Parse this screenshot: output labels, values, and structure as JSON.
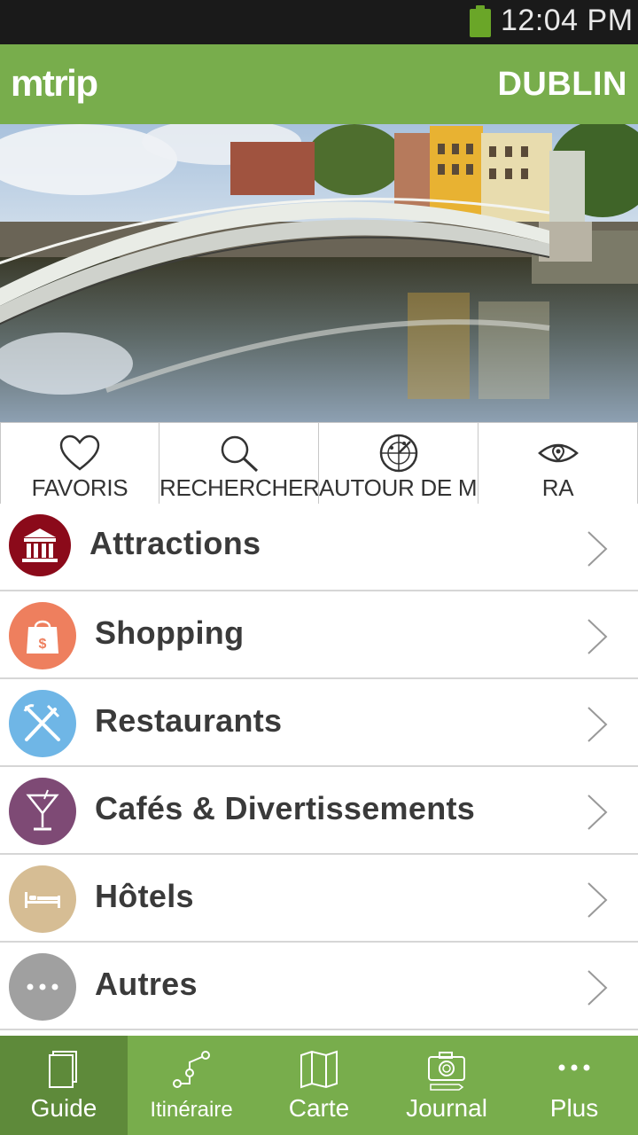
{
  "status_bar": {
    "time": "12:04 PM"
  },
  "header": {
    "logo": "mtrip",
    "city": "DUBLIN"
  },
  "quick_actions": [
    {
      "label": "FAVORIS",
      "icon": "heart-icon"
    },
    {
      "label": "RECHERCHER",
      "icon": "search-icon"
    },
    {
      "label": "AUTOUR DE MOI",
      "icon": "radar-icon"
    },
    {
      "label": "RA",
      "icon": "eye-icon"
    }
  ],
  "categories": [
    {
      "label": "Attractions",
      "icon": "museum-icon",
      "color": "#8b0a1a"
    },
    {
      "label": "Shopping",
      "icon": "shopping-bag-icon",
      "color": "#ee7f5e"
    },
    {
      "label": "Restaurants",
      "icon": "fork-knife-icon",
      "color": "#6fb6e6"
    },
    {
      "label": "Cafés & Divertissements",
      "icon": "cocktail-icon",
      "color": "#7e4a75"
    },
    {
      "label": "Hôtels",
      "icon": "bed-icon",
      "color": "#d6bd94"
    },
    {
      "label": "Autres",
      "icon": "more-icon",
      "color": "#a0a0a0"
    }
  ],
  "bottom_nav": [
    {
      "label": "Guide",
      "icon": "book-icon",
      "active": true
    },
    {
      "label": "Itinéraire",
      "icon": "route-icon",
      "active": false
    },
    {
      "label": "Carte",
      "icon": "map-icon",
      "active": false
    },
    {
      "label": "Journal",
      "icon": "camera-icon",
      "active": false
    },
    {
      "label": "Plus",
      "icon": "more-icon",
      "active": false
    }
  ],
  "colors": {
    "brand_green": "#78ad4c",
    "active_tab": "#5e8a3a"
  }
}
